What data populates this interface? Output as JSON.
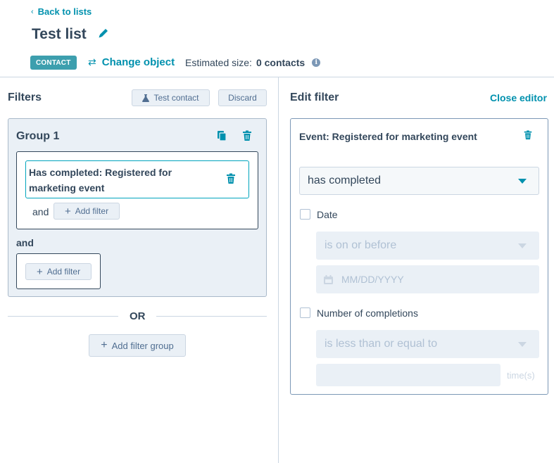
{
  "header": {
    "back_label": "Back to lists",
    "title": "Test list",
    "object_badge": "CONTACT",
    "change_object_label": "Change object",
    "estimated_size_label": "Estimated size:",
    "estimated_size_value": "0 contacts"
  },
  "filters_panel": {
    "title": "Filters",
    "test_contact_label": "Test contact",
    "discard_label": "Discard",
    "group": {
      "title": "Group 1",
      "filter_text": "Has completed: Registered for marketing event",
      "and_inner": "and",
      "add_filter_label": "Add filter",
      "and_outer": "and",
      "add_filter_outer_label": "Add filter"
    },
    "or_label": "OR",
    "add_filter_group_label": "Add filter group"
  },
  "edit_panel": {
    "title": "Edit filter",
    "close_label": "Close editor",
    "event_title": "Event: Registered for marketing event",
    "completion_select_value": "has completed",
    "date_label": "Date",
    "date_condition_placeholder": "is on or before",
    "date_input_placeholder": "MM/DD/YYYY",
    "completions_label": "Number of completions",
    "completions_condition_placeholder": "is less than or equal to",
    "times_suffix": "time(s)"
  },
  "colors": {
    "accent": "#0091ae",
    "badge": "#3d9fae",
    "text": "#33475b",
    "panel_bg": "#eaf0f6"
  }
}
